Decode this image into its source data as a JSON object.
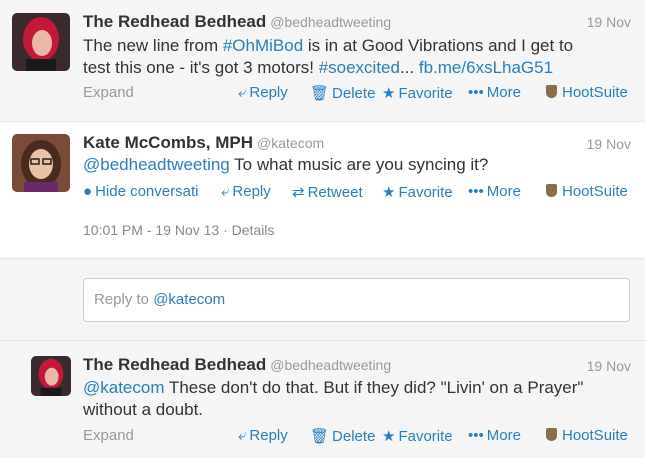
{
  "tweets": [
    {
      "name": "The Redhead Bedhead",
      "handle": "@bedheadtweeting",
      "date": "19 Nov",
      "text_line1_pre": "The new line from ",
      "text_line1_tag": "#OhMiBod",
      "text_line1_post": " is in at Good Vibrations and I get to",
      "text_line2_pre": "test this one - it's got 3 motors! ",
      "text_line2_tag": "#soexcited",
      "text_line2_mid": "... ",
      "text_line2_link": "fb.me/6xsLhaG51",
      "expand": "Expand",
      "reply": "Reply",
      "delete": "Delete",
      "favorite": "Favorite",
      "more": "More",
      "hootsuite": "HootSuite"
    },
    {
      "name": "Kate McCombs, MPH",
      "handle": "@katecom",
      "date": "19 Nov",
      "mention": "@bedheadtweeting",
      "text_rest": " To what music are you syncing it?",
      "hide": "Hide conversati",
      "reply": "Reply",
      "retweet": "Retweet",
      "favorite": "Favorite",
      "more": "More",
      "hootsuite": "HootSuite",
      "details": "10:01 PM - 19 Nov 13 · Details"
    },
    {
      "name": "The Redhead Bedhead",
      "handle": "@bedheadtweeting",
      "date": "19 Nov",
      "mention": "@katecom",
      "text_line1_rest": " These don't do that. But if they did? \"Livin' on a Prayer\"",
      "text_line2": "without a doubt.",
      "expand": "Expand",
      "reply": "Reply",
      "delete": "Delete",
      "favorite": "Favorite",
      "more": "More",
      "hootsuite": "HootSuite"
    }
  ],
  "reply_box": {
    "prefix": "Reply to ",
    "mention": "@katecom"
  },
  "icons": {
    "reply": "reply-arrow-icon",
    "delete": "trash-icon",
    "favorite": "star-icon",
    "more": "dots-icon",
    "hootsuite": "hootsuite-owl-icon",
    "retweet": "retweet-icon",
    "hide": "speech-bubble-icon"
  },
  "colors": {
    "link": "#2a7fbf",
    "muted": "#999999",
    "bg_alt": "#f5f5f5"
  }
}
